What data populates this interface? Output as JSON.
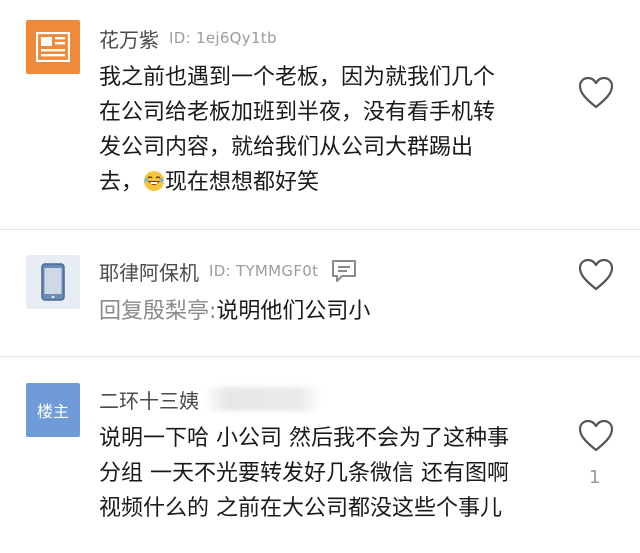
{
  "comments": [
    {
      "name": "花万紫",
      "uid": "ID: 1ej6Qy1tb",
      "lines": [
        "我之前也遇到一个老板，因为就我们几个",
        "在公司给老板加班到半夜，没有看手机转",
        "发公司内容，就给我们从公司大群踢出",
        "去，"
      ],
      "line4_tail": "现在想想都好笑",
      "avatar_icon": "newspaper-icon",
      "avatar_color": "#ef8a3a"
    },
    {
      "name": "耶律阿保机",
      "uid": "ID: TYMMGF0t",
      "reply_prefix": "回复殷梨亭:",
      "reply_text": "说明他们公司小",
      "avatar_icon": "phone-icon"
    },
    {
      "name": "二环十三姨",
      "avatar_label": "楼主",
      "avatar_color": "#6f9bd8",
      "lines": [
        "说明一下哈 小公司 然后我不会为了这种事",
        "分组 一天不光要转发好几条微信 还有图啊",
        "视频什么的 之前在大公司都没这些个事儿"
      ],
      "likes": "1"
    }
  ]
}
